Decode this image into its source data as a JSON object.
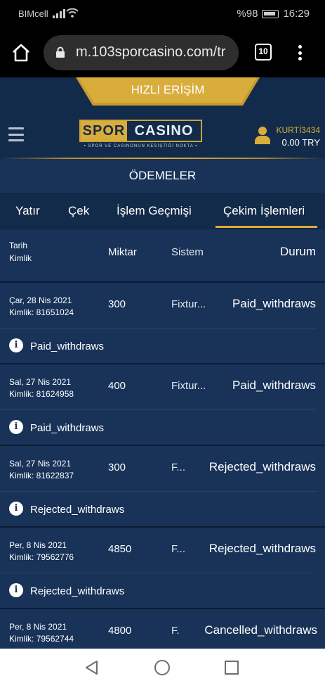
{
  "status_bar": {
    "carrier": "BIMcell",
    "battery": "%98",
    "time": "16:29"
  },
  "browser": {
    "url": "m.103sporcasino.com/tr",
    "tab_count": "10"
  },
  "site": {
    "quick_access": "HIZLI ERİŞİM",
    "logo_spor": "SPOR",
    "logo_casino": "CASINO",
    "logo_tagline": "• SPOR VE CASINONUN KESİŞTİĞİ NOKTA •",
    "username": "KURTİ3434",
    "balance": "0.00 TRY",
    "accent_color": "#d8ad3c",
    "background_color": "#132b4a"
  },
  "page_title": "ÖDEMELER",
  "tabs": [
    {
      "label": "Yatır"
    },
    {
      "label": "Çek"
    },
    {
      "label": "İşlem Geçmişi"
    },
    {
      "label": "Çekim İşlemleri",
      "active": true
    }
  ],
  "table": {
    "headers": {
      "date": "Tarih",
      "id": "Kimlik",
      "amount": "Miktar",
      "system": "Sistem",
      "status": "Durum"
    },
    "rows": [
      {
        "date": "Çar, 28 Nis 2021",
        "id": "Kimlik: 81651024",
        "amount": "300",
        "system": "Fixtur...",
        "status": "Paid_withdraws",
        "info": "Paid_withdraws"
      },
      {
        "date": "Sal, 27 Nis 2021",
        "id": "Kimlik: 81624958",
        "amount": "400",
        "system": "Fixtur...",
        "status": "Paid_withdraws",
        "info": "Paid_withdraws"
      },
      {
        "date": "Sal, 27 Nis 2021",
        "id": "Kimlik: 81622837",
        "amount": "300",
        "system": "F...",
        "status": "Rejected_withdraws",
        "info": "Rejected_withdraws"
      },
      {
        "date": "Per, 8 Nis 2021",
        "id": "Kimlik: 79562776",
        "amount": "4850",
        "system": "F...",
        "status": "Rejected_withdraws",
        "info": "Rejected_withdraws"
      },
      {
        "date": "Per, 8 Nis 2021",
        "id": "Kimlik: 79562744",
        "amount": "4800",
        "system": "F.",
        "status": "Cancelled_withdraws",
        "info": ""
      }
    ]
  }
}
